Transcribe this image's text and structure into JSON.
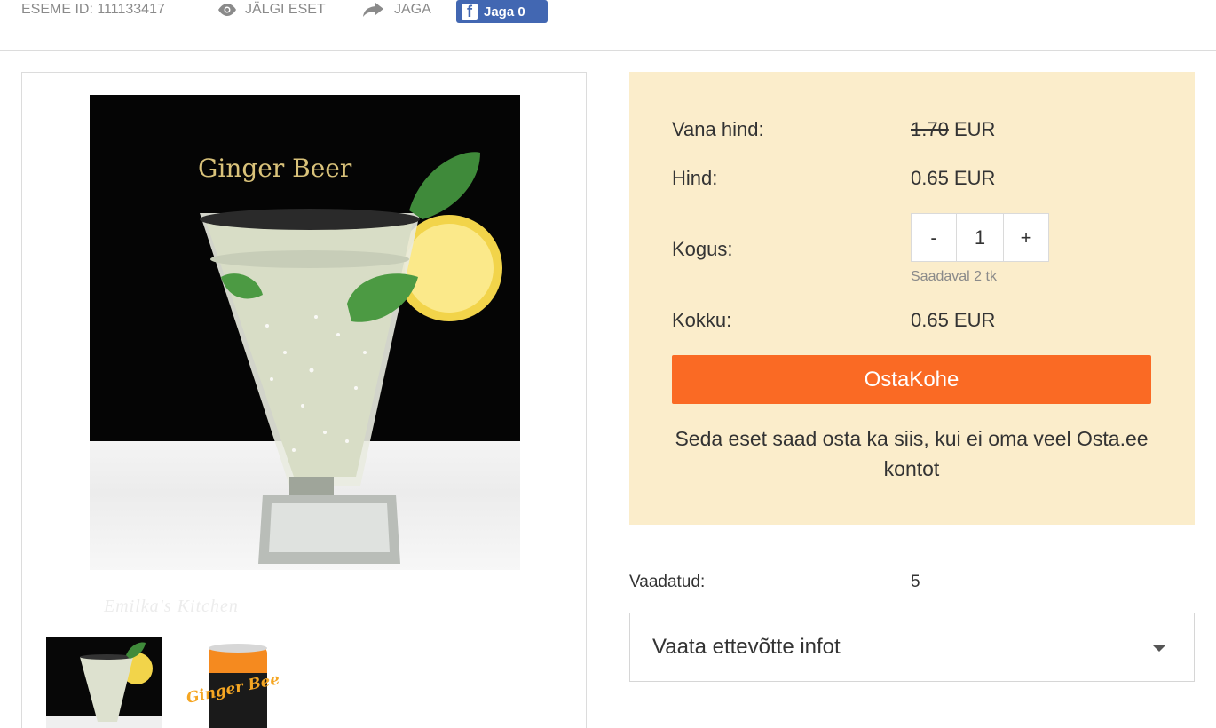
{
  "topbar": {
    "item_id": "ESEME ID: 111133417",
    "watch_label": "JÄLGI ESET",
    "share_label": "JAGA",
    "fb_label": "Jaga 0"
  },
  "gallery": {
    "image_caption": "Ginger Beer",
    "watermark": "Emilka's Kitchen",
    "thumb_can_text": "Ginger Beer"
  },
  "price": {
    "old_price_label": "Vana hind:",
    "old_price_value": "1.70",
    "old_price_currency": " EUR",
    "price_label": "Hind:",
    "price_value": "0.65 EUR",
    "qty_label": "Kogus:",
    "qty_minus": "-",
    "qty_value": "1",
    "qty_plus": "+",
    "available": "Saadaval 2 tk",
    "total_label": "Kokku:",
    "total_value": "0.65 EUR",
    "buy_button": "OstaKohe",
    "note": "Seda eset saad osta ka siis, kui ei oma veel Osta.ee kontot"
  },
  "stats": {
    "viewed_label": "Vaadatud:",
    "viewed_value": "5"
  },
  "company": {
    "label": "Vaata ettevõtte infot"
  },
  "colors": {
    "accent": "#fa6a24",
    "pricebox_bg": "#fbedcb",
    "facebook": "#4267b2"
  }
}
